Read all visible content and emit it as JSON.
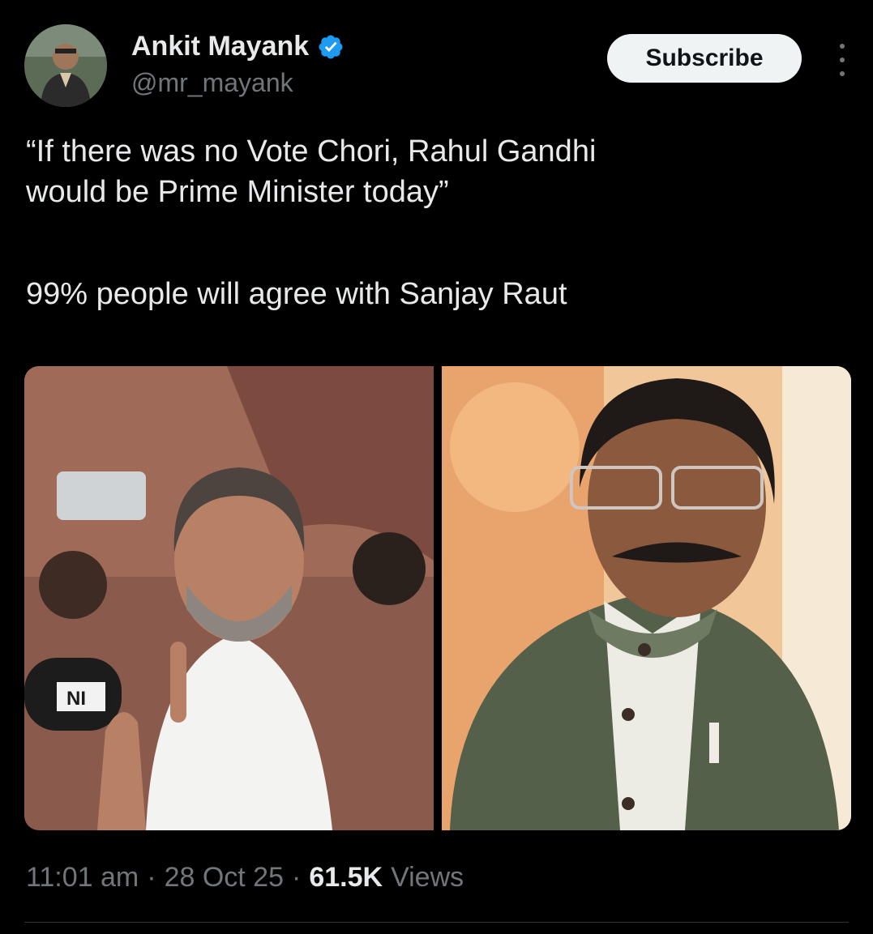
{
  "author": {
    "display_name": "Ankit Mayank",
    "handle": "@mr_mayank",
    "verified_icon": "verified-badge-icon",
    "verified_color": "#1d9bf0"
  },
  "actions": {
    "subscribe_label": "Subscribe",
    "more_icon": "more-vertical-icon"
  },
  "tweet": {
    "line1": "“If there was no Vote Chori, Rahul Gandhi",
    "line2": "would be Prime Minister today”",
    "line3": "99% people will agree with Sanjay Raut"
  },
  "media": {
    "left_mic_label": "NI"
  },
  "meta": {
    "time": "11:01 am",
    "date": "28 Oct 25",
    "views_count": "61.5K",
    "views_label": "Views",
    "separator": "·"
  },
  "colors": {
    "background": "#000000",
    "text_primary": "#e7e9ea",
    "text_secondary": "#71767b",
    "subscribe_bg": "#eff3f4"
  }
}
